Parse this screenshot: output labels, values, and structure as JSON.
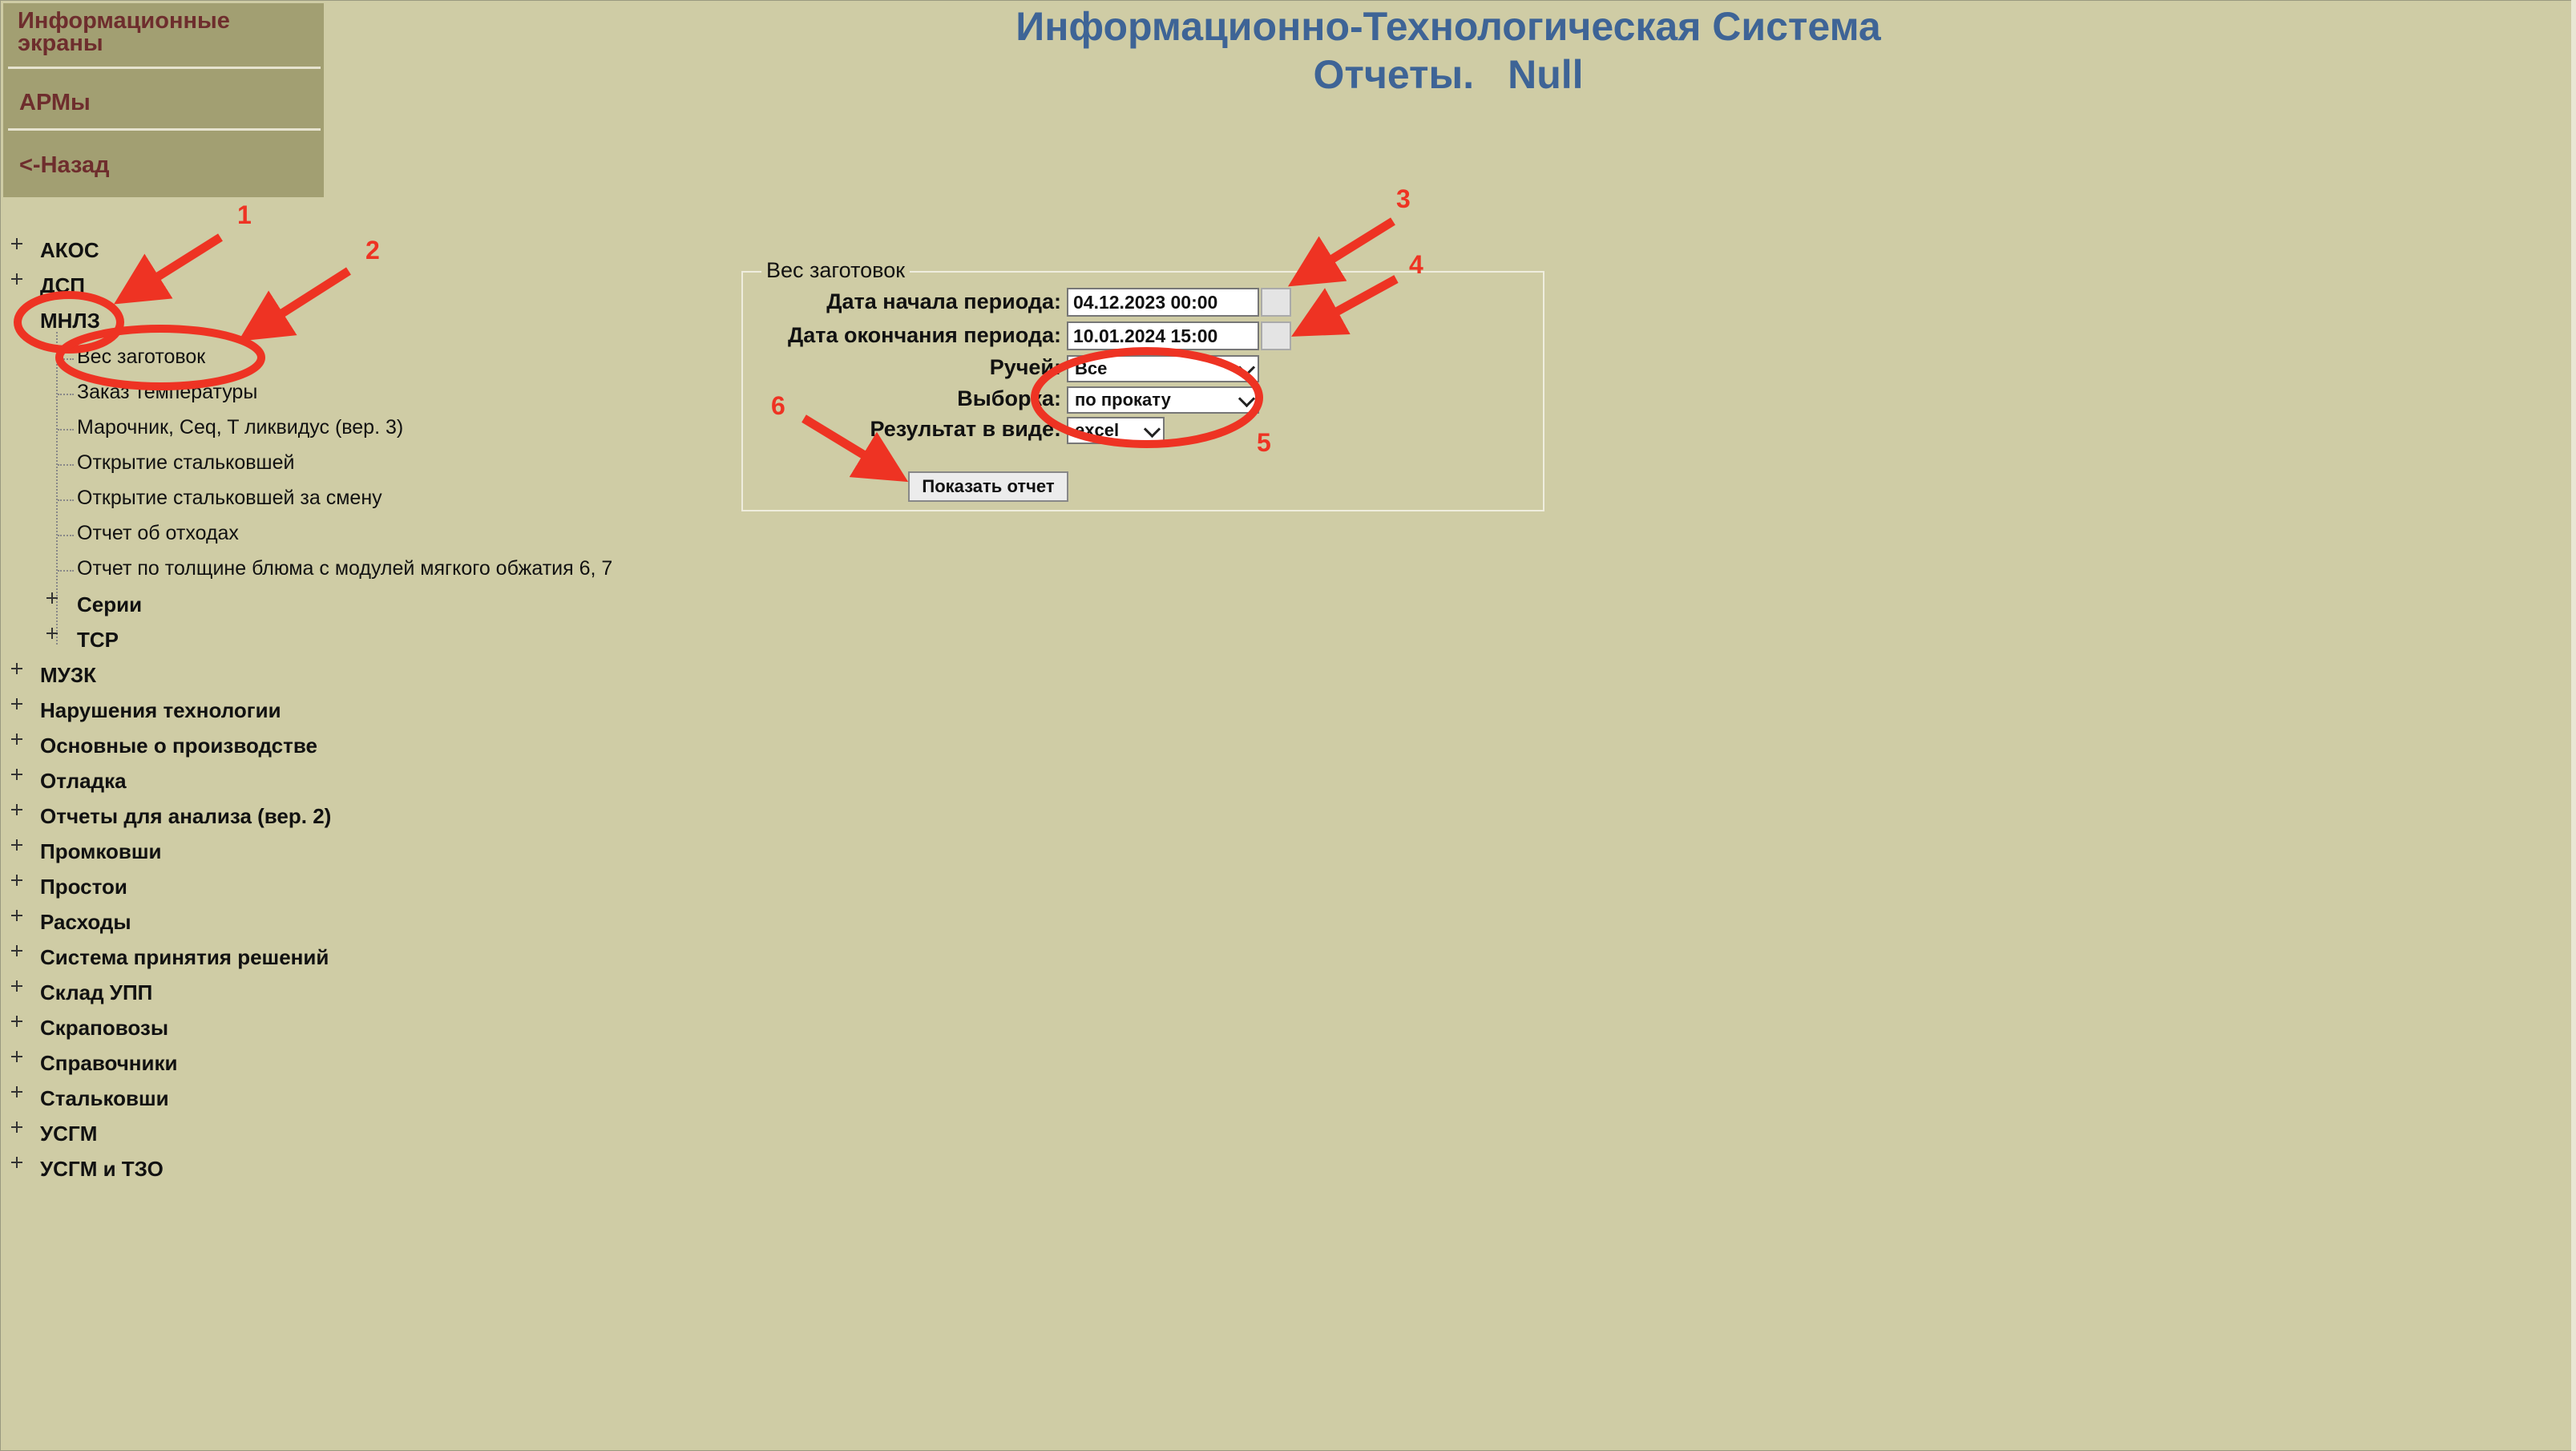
{
  "header": {
    "title": "Информационно-Технологическая Система",
    "subtitle_left": "Отчеты.",
    "subtitle_right": "Null"
  },
  "topmenu": {
    "item1": "Информационные экраны",
    "item2": "АРМы",
    "item3": "<-Назад"
  },
  "tree": {
    "akos": "АКОС",
    "dsp": "ДСП",
    "mnlz": "МНЛЗ",
    "mnlz_children": [
      "Вес заготовок",
      "Заказ температуры",
      "Марочник, Сeq, T ликвидус (вер. 3)",
      "Открытие стальковшей",
      "Открытие стальковшей за смену",
      "Отчет об отходах",
      "Отчет по толщине блюма с модулей мягкого обжатия 6, 7"
    ],
    "series": "Серии",
    "tsr": "ТСР",
    "rest": [
      "МУЗК",
      "Нарушения технологии",
      "Основные о производстве",
      "Отладка",
      "Отчеты для анализа (вер. 2)",
      "Промковши",
      "Простои",
      "Расходы",
      "Система принятия решений",
      "Склад УПП",
      "Скраповозы",
      "Справочники",
      "Стальковши",
      "УСГМ",
      "УСГМ и ТЗО"
    ]
  },
  "form": {
    "legend": "Вес заготовок",
    "start_label": "Дата начала периода:",
    "start_value": "04.12.2023 00:00",
    "end_label": "Дата окончания периода:",
    "end_value": "10.01.2024 15:00",
    "stream_label": "Ручей:",
    "stream_value": "Все",
    "sample_label": "Выборка:",
    "sample_value": "по прокату",
    "result_label": "Результат в виде:",
    "result_value": "excel",
    "submit": "Показать отчет"
  },
  "annotations": {
    "n1": "1",
    "n2": "2",
    "n3": "3",
    "n4": "4",
    "n5": "5",
    "n6": "6"
  },
  "colors": {
    "background": "#cfcca5",
    "menu": "#a29f72",
    "title": "#3e6496",
    "annotation": "#ee3323"
  }
}
